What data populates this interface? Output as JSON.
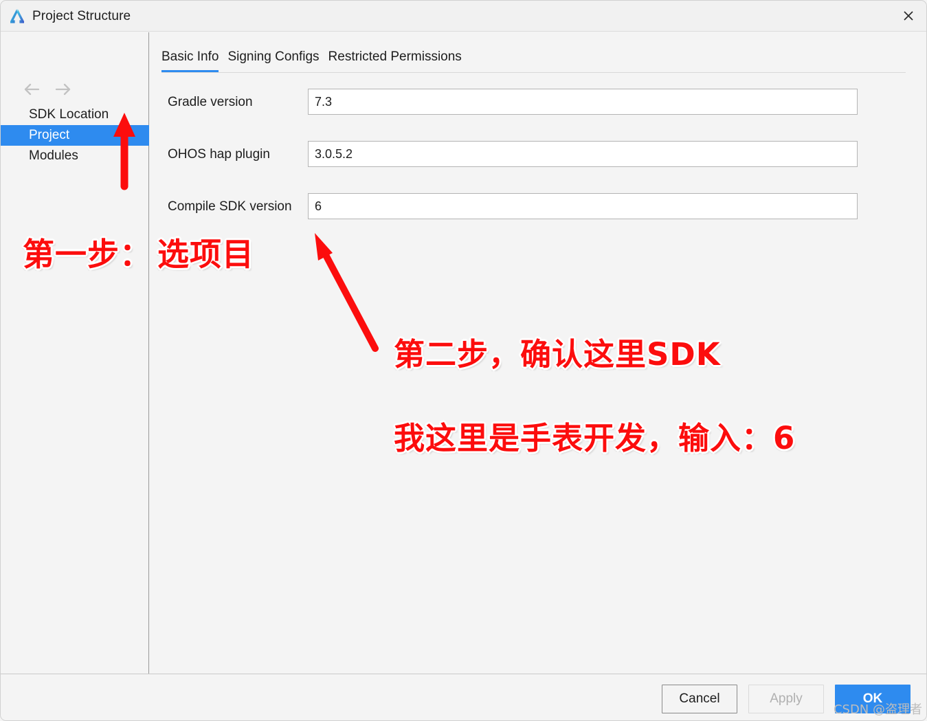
{
  "window": {
    "title": "Project Structure",
    "logo_icon": "deveco-studio-logo",
    "close_icon": "close-icon"
  },
  "sidebar": {
    "back_icon": "arrow-left-icon",
    "forward_icon": "arrow-right-icon",
    "items": [
      {
        "label": "SDK Location",
        "selected": false
      },
      {
        "label": "Project",
        "selected": true
      },
      {
        "label": "Modules",
        "selected": false
      }
    ]
  },
  "tabs": [
    {
      "label": "Basic Info",
      "active": true
    },
    {
      "label": "Signing Configs",
      "active": false
    },
    {
      "label": "Restricted Permissions",
      "active": false
    }
  ],
  "form": {
    "rows": [
      {
        "label": "Gradle version",
        "value": "7.3",
        "placeholder": ""
      },
      {
        "label": "OHOS hap plugin",
        "value": "3.0.5.2",
        "placeholder": ""
      },
      {
        "label": "Compile SDK version",
        "value": "6",
        "placeholder": ""
      }
    ]
  },
  "buttons": {
    "cancel": "Cancel",
    "apply": "Apply",
    "ok": "OK"
  },
  "annotations": {
    "step1_a": "第一步：",
    "step1_b": "选项目",
    "step2": "第二步，确认这里SDK",
    "step3": "我这里是手表开发，输入：6",
    "arrow_up_icon": "red-arrow-up",
    "arrow_diagonal_icon": "red-arrow-up-left"
  },
  "watermark": "CSDN @盗理者",
  "colors": {
    "accent": "#2e8bef",
    "annotation_red": "#fc0d0d",
    "window_bg": "#f4f4f4",
    "title_bg": "#f1f1f1"
  }
}
